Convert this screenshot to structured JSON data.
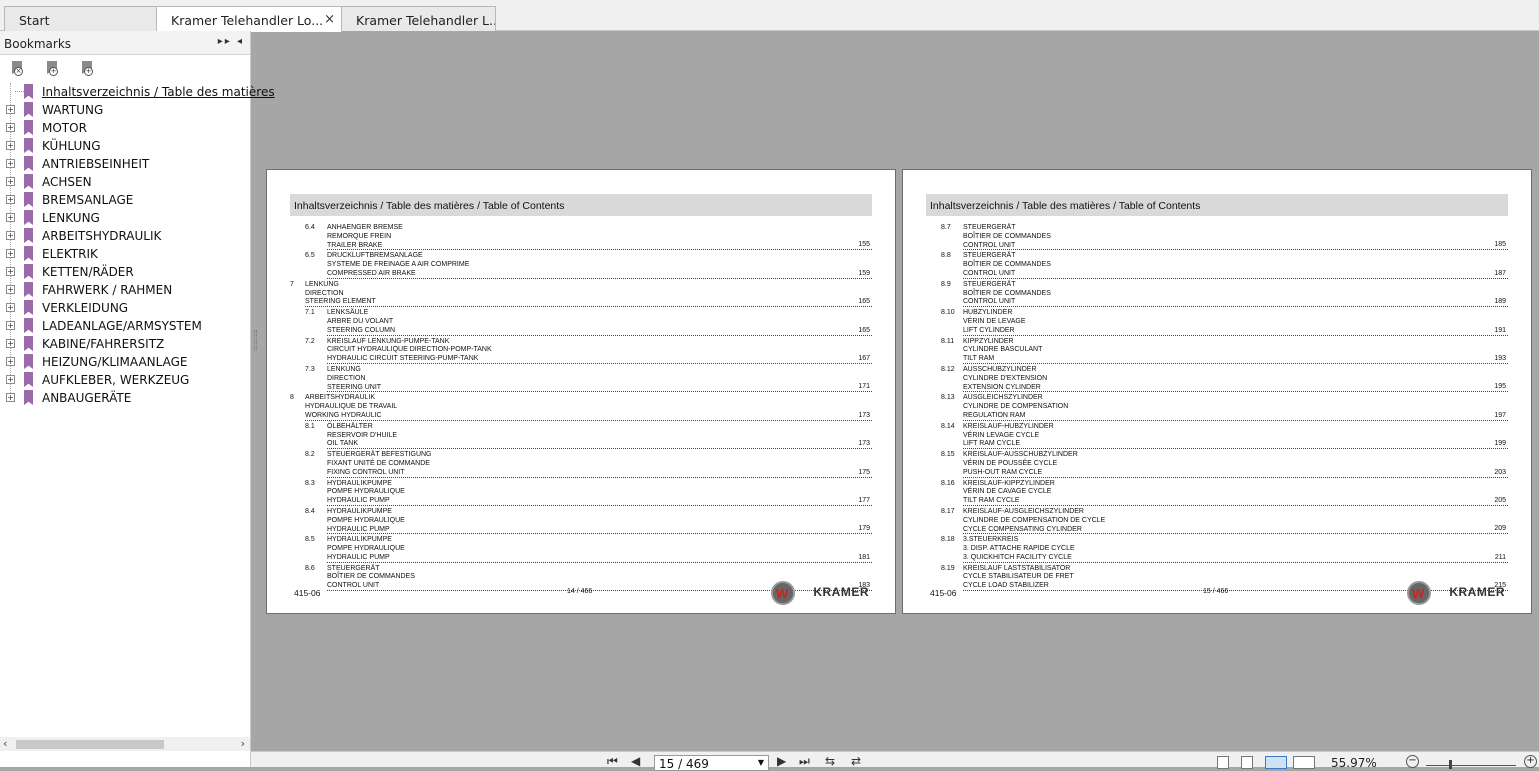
{
  "tabs": [
    {
      "label": "Start"
    },
    {
      "label": "Kramer Telehandler Lo...",
      "close": "×"
    },
    {
      "label": "Kramer Telehandler L..."
    }
  ],
  "sidebar": {
    "title": "Bookmarks",
    "header_controls": "▸▸ ◂",
    "tool_icons": [
      "delete-bookmark-icon",
      "add-bookmark-icon",
      "add-child-bookmark-icon"
    ],
    "items": [
      {
        "label": "Inhaltsverzeichnis / Table des matières",
        "expandable": false
      },
      {
        "label": "WARTUNG",
        "expandable": true
      },
      {
        "label": "MOTOR",
        "expandable": true
      },
      {
        "label": "KÜHLUNG",
        "expandable": true
      },
      {
        "label": "ANTRIEBSEINHEIT",
        "expandable": true
      },
      {
        "label": "ACHSEN",
        "expandable": true
      },
      {
        "label": "BREMSANLAGE",
        "expandable": true
      },
      {
        "label": "LENKUNG",
        "expandable": true
      },
      {
        "label": "ARBEITSHYDRAULIK",
        "expandable": true
      },
      {
        "label": "ELEKTRIK",
        "expandable": true
      },
      {
        "label": "KETTEN/RÄDER",
        "expandable": true
      },
      {
        "label": "FAHRWERK / RAHMEN",
        "expandable": true
      },
      {
        "label": "VERKLEIDUNG",
        "expandable": true
      },
      {
        "label": "LADEANLAGE/ARMSYSTEM",
        "expandable": true
      },
      {
        "label": "KABINE/FAHRERSITZ",
        "expandable": true
      },
      {
        "label": "HEIZUNG/KLIMAANLAGE",
        "expandable": true
      },
      {
        "label": "AUFKLEBER, WERKZEUG",
        "expandable": true
      },
      {
        "label": "ANBAUGERÄTE",
        "expandable": true
      }
    ],
    "expander_symbol": "+"
  },
  "pages": [
    {
      "header": "Inhaltsverzeichnis / Table des matières / Table of Contents",
      "entries": [
        {
          "num": "6.4",
          "level": 2,
          "lines": [
            "ANHAENGER BREMSE",
            "REMORQUE FREIN",
            "TRAILER BRAKE"
          ],
          "page": "155"
        },
        {
          "num": "6.5",
          "level": 2,
          "lines": [
            "DRUCKLUFTBREMSANLAGE",
            "SYSTEME DE FREINAGE A AIR COMPRIME",
            "COMPRESSED AIR BRAKE"
          ],
          "page": "159"
        },
        {
          "num": "7",
          "level": 1,
          "lines": [
            "LENKUNG",
            "DIRECTION",
            "STEERING ELEMENT"
          ],
          "page": "165"
        },
        {
          "num": "7.1",
          "level": 2,
          "lines": [
            "LENKSÄULE",
            "ARBRE DU VOLANT",
            "STEERING COLUMN"
          ],
          "page": "165"
        },
        {
          "num": "7.2",
          "level": 2,
          "lines": [
            "KREISLAUF LENKUNG-PUMPE-TANK",
            "CIRCUIT HYDRAULIQUE DIRECTION-POMP-TANK",
            "HYDRAULIC CIRCUIT STEERING-PUMP-TANK"
          ],
          "page": "167"
        },
        {
          "num": "7.3",
          "level": 2,
          "lines": [
            "LENKUNG",
            "DIRECTION",
            "STEERING UNIT"
          ],
          "page": "171"
        },
        {
          "num": "8",
          "level": 1,
          "lines": [
            "ARBEITSHYDRAULIK",
            "HYDRAULIQUE DE TRAVAIL",
            "WORKING HYDRAULIC"
          ],
          "page": "173"
        },
        {
          "num": "8.1",
          "level": 2,
          "lines": [
            "ÖLBEHÄLTER",
            "RESERVOIR D'HUILE",
            "OIL TANK"
          ],
          "page": "173"
        },
        {
          "num": "8.2",
          "level": 2,
          "lines": [
            "STEUERGERÄT BEFESTIGUNG",
            "FIXANT UNITÉ DE COMMANDE",
            "FIXING CONTROL UNIT"
          ],
          "page": "175"
        },
        {
          "num": "8.3",
          "level": 2,
          "lines": [
            "HYDRAULIKPUMPE",
            "POMPE HYDRAULIQUE",
            "HYDRAULIC PUMP"
          ],
          "page": "177"
        },
        {
          "num": "8.4",
          "level": 2,
          "lines": [
            "HYDRAULIKPUMPE",
            "POMPE HYDRAULIQUE",
            "HYDRAULIC PUMP"
          ],
          "page": "179"
        },
        {
          "num": "8.5",
          "level": 2,
          "lines": [
            "HYDRAULIKPUMPE",
            "POMPE HYDRAULIQUE",
            "HYDRAULIC PUMP"
          ],
          "page": "181"
        },
        {
          "num": "8.6",
          "level": 2,
          "lines": [
            "STEUERGERÄT",
            "BOÎTIER DE COMMANDES",
            "CONTROL UNIT"
          ],
          "page": "183"
        }
      ],
      "footer_left": "415-06",
      "footer_mid": "14 / 466",
      "brand": "KRAMER"
    },
    {
      "header": "Inhaltsverzeichnis / Table des matières / Table of Contents",
      "entries": [
        {
          "num": "8.7",
          "level": 2,
          "lines": [
            "STEUERGERÄT",
            "BOÎTIER DE COMMANDES",
            "CONTROL UNIT"
          ],
          "page": "185"
        },
        {
          "num": "8.8",
          "level": 2,
          "lines": [
            "STEUERGERÄT",
            "BOÎTIER DE COMMANDES",
            "CONTROL UNIT"
          ],
          "page": "187"
        },
        {
          "num": "8.9",
          "level": 2,
          "lines": [
            "STEUERGERÄT",
            "BOÎTIER DE COMMANDES",
            "CONTROL UNIT"
          ],
          "page": "189"
        },
        {
          "num": "8.10",
          "level": 2,
          "lines": [
            "HUBZYLINDER",
            "VÉRIN DE LEVAGE",
            "LIFT CYLINDER"
          ],
          "page": "191"
        },
        {
          "num": "8.11",
          "level": 2,
          "lines": [
            "KIPPZYLINDER",
            "CYLINDRE BASCULANT",
            "TILT RAM"
          ],
          "page": "193"
        },
        {
          "num": "8.12",
          "level": 2,
          "lines": [
            "AUSSCHUBZYLINDER",
            "CYLINDRE D'EXTENSION",
            "EXTENSION CYLINDER"
          ],
          "page": "195"
        },
        {
          "num": "8.13",
          "level": 2,
          "lines": [
            "AUSGLEICHSZYLINDER",
            "CYLINDRE DE COMPENSATION",
            "REGULATION RAM"
          ],
          "page": "197"
        },
        {
          "num": "8.14",
          "level": 2,
          "lines": [
            "KREISLAUF-HUBZYLINDER",
            "VÉRIN LEVAGE CYCLE",
            "LIFT RAM CYCLE"
          ],
          "page": "199"
        },
        {
          "num": "8.15",
          "level": 2,
          "lines": [
            "KREISLAUF-AUSSCHUBZYLINDER",
            "VÉRIN DE POUSSÉE CYCLE",
            "PUSH-OUT RAM CYCLE"
          ],
          "page": "203"
        },
        {
          "num": "8.16",
          "level": 2,
          "lines": [
            "KREISLAUF-KIPPZYLINDER",
            "VÉRIN DE CAVAGE CYCLE",
            "TILT RAM CYCLE"
          ],
          "page": "205"
        },
        {
          "num": "8.17",
          "level": 2,
          "lines": [
            "KREISLAUF-AUSGLEICHSZYLINDER",
            "CYLINDRE DE COMPENSATION DE CYCLE",
            "CYCLE COMPENSATING CYLINDER"
          ],
          "page": "209"
        },
        {
          "num": "8.18",
          "level": 2,
          "lines": [
            "3.STEUERKREIS",
            "3. DISP. ATTACHE RAPIDE CYCLE",
            "3. QUICKHITCH FACILITY CYCLE"
          ],
          "page": "211"
        },
        {
          "num": "8.19",
          "level": 2,
          "lines": [
            "KREISLAUF LASTSTABILISATOR",
            "CYCLE STABILISATEUR DE FRET",
            "CYCLE LOAD STABILIZER"
          ],
          "page": "215"
        }
      ],
      "footer_left": "415-06",
      "footer_mid": "15 / 466",
      "brand": "KRAMER"
    }
  ],
  "statusbar": {
    "page_indicator": "15 / 469",
    "zoom": "55.97%",
    "nav_icons": [
      "first-page-icon",
      "prev-page-icon",
      "next-page-icon",
      "last-page-icon"
    ]
  },
  "colors": {
    "viewer_bg": "#a6a6a6",
    "bookmark": "#9b6aa8",
    "page_header_bg": "#d9d9d9",
    "brand_red": "#d12020"
  }
}
